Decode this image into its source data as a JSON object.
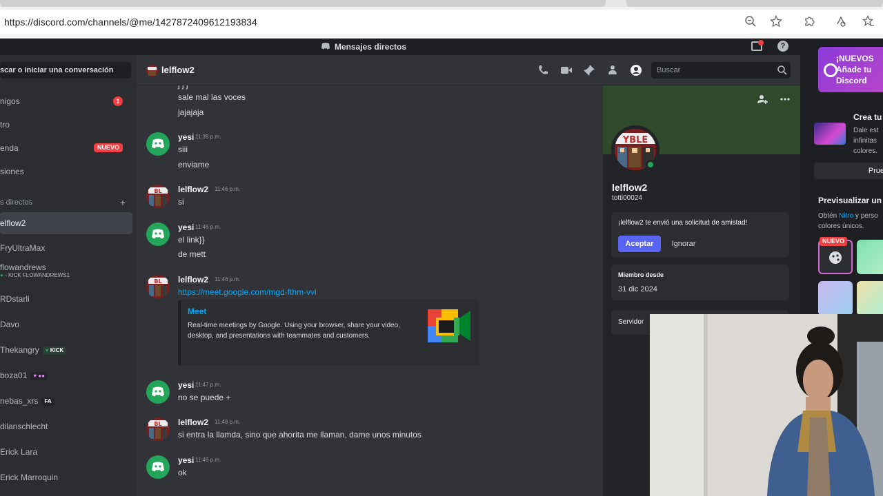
{
  "browser": {
    "url": "https://discord.com/channels/@me/1427872409612193834"
  },
  "topbar": {
    "title": "Mensajes directos"
  },
  "sidebar": {
    "search_label": "scar o iniciar una conversación",
    "nav": [
      {
        "label": "nigos",
        "badge": "1"
      },
      {
        "label": "tro"
      },
      {
        "label": "enda",
        "badge_new": "NUEVO"
      },
      {
        "label": "siones"
      }
    ],
    "dm_header": "s directos",
    "dm_add": "+",
    "dms": [
      {
        "name": "elflow2",
        "active": true
      },
      {
        "name": "FryUltraMax"
      },
      {
        "name": "flowandrews",
        "sub": "- KICK FLOWANDREWS1"
      },
      {
        "name": "RDstarli"
      },
      {
        "name": "Davo"
      },
      {
        "name": "Thekangry",
        "tag": "KICK"
      },
      {
        "name": "boza01",
        "tag": "♥ ●● "
      },
      {
        "name": "nebas_xrs",
        "tag": "FA"
      },
      {
        "name": "dilanschlecht"
      },
      {
        "name": "Erick Lara"
      },
      {
        "name": "Erick Marroquin"
      }
    ]
  },
  "channel": {
    "name": "lelflow2",
    "search_placeholder": "Buscar"
  },
  "messages": [
    {
      "lines": [
        "sale mal las voces",
        "jajajaja"
      ]
    },
    {
      "author": "yesi",
      "time": "11:39 p.m.",
      "lines": [
        "siii",
        "enviame"
      ]
    },
    {
      "author": "lelflow2",
      "time": "11:46 p.m.",
      "lines": [
        "si"
      ]
    },
    {
      "author": "yesi",
      "time": "11:46 p.m.",
      "lines": [
        "el link}}",
        "de mett"
      ]
    },
    {
      "author": "lelflow2",
      "time": "11:46 p.m.",
      "link": "https://meet.google.com/mgd-fthm-vvi",
      "embed": {
        "title": "Meet",
        "desc": "Real-time meetings by Google. Using your browser, share your video, desktop, and presentations with teammates and customers."
      }
    },
    {
      "author": "yesi",
      "time": "11:47 p.m.",
      "lines": [
        "no se puede +"
      ]
    },
    {
      "author": "lelflow2",
      "time": "11:48 p.m.",
      "lines": [
        "si entra la llamda, sino que ahorita me llaman, dame unos minutos"
      ]
    },
    {
      "author": "yesi",
      "time": "11:49 p.m.",
      "lines": [
        "ok"
      ]
    }
  ],
  "profile": {
    "display_name": "lelflow2",
    "username": "totti00024",
    "friend_request": "¡lelflow2 te envió una solicitud de amistad!",
    "accept": "Aceptar",
    "ignore": "Ignorar",
    "member_since_label": "Miembro desde",
    "member_since": "31 dic 2024",
    "servers_label": "Servidor"
  },
  "nitro": {
    "banner_lines": [
      "¡NUEVOS",
      "Añade tu",
      "Discord"
    ],
    "crea_title": "Crea tu",
    "crea_desc": [
      "Dale est",
      "infinitas",
      "colores."
    ],
    "prue_label": "Prue",
    "preview_title": "Previsualizar un",
    "preview_desc_1a": "Obtén ",
    "preview_desc_1b": "Nitro",
    "preview_desc_1c": " y perso",
    "preview_desc_2": "colores únicos.",
    "new_tag": "NUEVO"
  },
  "colors": {
    "accent": "#5865f2",
    "online": "#23a55a",
    "danger": "#f23f43",
    "link": "#00a8fc"
  }
}
